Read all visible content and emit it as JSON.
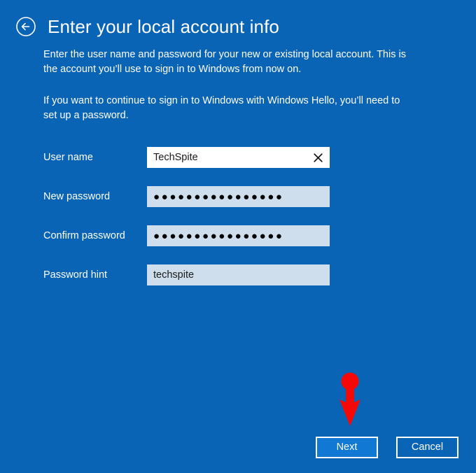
{
  "window": {
    "title": "Enter your local account info",
    "background_color": "#0a64b5"
  },
  "header": {
    "back_icon": "back-arrow-circle-icon",
    "title": "Enter your local account info"
  },
  "description": {
    "paragraph_1": "Enter the user name and password for your new or existing local account. This is the account you’ll use to sign in to Windows from now on.",
    "paragraph_2": "If you want to continue to sign in to Windows with Windows Hello, you’ll need to set up a password."
  },
  "form": {
    "fields": [
      {
        "label": "User name",
        "value": "TechSpite",
        "masked": false,
        "active": true,
        "has_clear_button": true,
        "clear_icon": "close-x-icon"
      },
      {
        "label": "New password",
        "value": "●●●●●●●●●●●●●●●●",
        "masked": true,
        "active": false,
        "has_clear_button": false
      },
      {
        "label": "Confirm password",
        "value": "●●●●●●●●●●●●●●●●",
        "masked": true,
        "active": false,
        "has_clear_button": false
      },
      {
        "label": "Password hint",
        "value": "techspite",
        "masked": false,
        "active": false,
        "has_clear_button": false
      }
    ]
  },
  "annotation": {
    "arrow_color": "#f60808",
    "arrow_direction": "down",
    "points_to": "next-button"
  },
  "footer": {
    "next_label": "Next",
    "cancel_label": "Cancel",
    "next_color": "#1178d4"
  }
}
